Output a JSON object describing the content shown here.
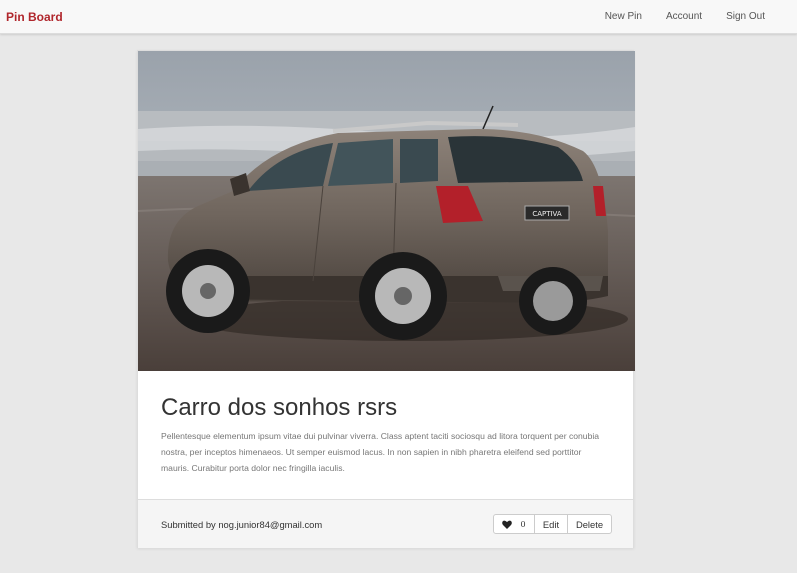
{
  "navbar": {
    "brand": "Pin Board",
    "links": [
      "New Pin",
      "Account",
      "Sign Out"
    ]
  },
  "pin": {
    "title": "Carro dos sonhos rsrs",
    "description": "Pellentesque elementum ipsum vitae dui pulvinar viverra. Class aptent taciti sociosqu ad litora torquent per conubia nostra, per inceptos himenaeos. Ut semper euismod lacus. In non sapien in nibh pharetra eleifend sed porttitor mauris. Curabitur porta dolor nec fringilla iaculis.",
    "image_label": "CAPTIVA",
    "submitted_by": "Submitted by nog.junior84@gmail.com",
    "like_count": "0",
    "edit_label": "Edit",
    "delete_label": "Delete"
  },
  "colors": {
    "brand": "#b0262c",
    "page_bg": "#e8e8e8",
    "footer_bg": "#f5f5f5"
  }
}
